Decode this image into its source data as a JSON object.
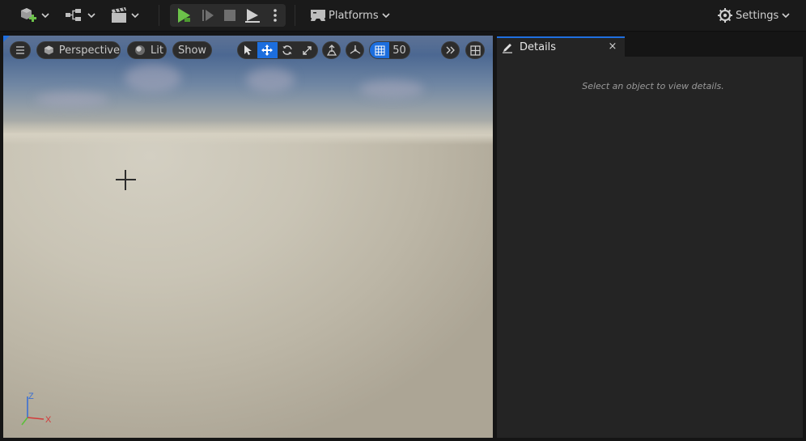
{
  "toolbar": {
    "platforms_label": "Platforms",
    "settings_label": "Settings",
    "icons": {
      "add": "add-actor-icon",
      "blueprint": "blueprint-icon",
      "cinematics": "clapperboard-icon",
      "play": "play-icon",
      "advance_frame": "advance-frame-icon",
      "stop": "stop-icon",
      "eject": "eject-icon",
      "more": "more-options-icon",
      "platforms": "gamepad-icon",
      "settings": "gear-icon"
    },
    "colors": {
      "play_green": "#6cc24a",
      "accent_blue": "#1f6fe0"
    }
  },
  "viewport": {
    "view_mode_label": "Perspective",
    "lit_label": "Lit",
    "show_label": "Show",
    "grid_snap_value": "50",
    "axis": {
      "z": "Z",
      "x": "X"
    },
    "colors": {
      "axis_x": "#d33a3a",
      "axis_y": "#5bbf3a",
      "axis_z": "#3a6fd3"
    }
  },
  "details": {
    "tab_title": "Details",
    "close_glyph": "×",
    "empty_message": "Select an object to view details."
  }
}
